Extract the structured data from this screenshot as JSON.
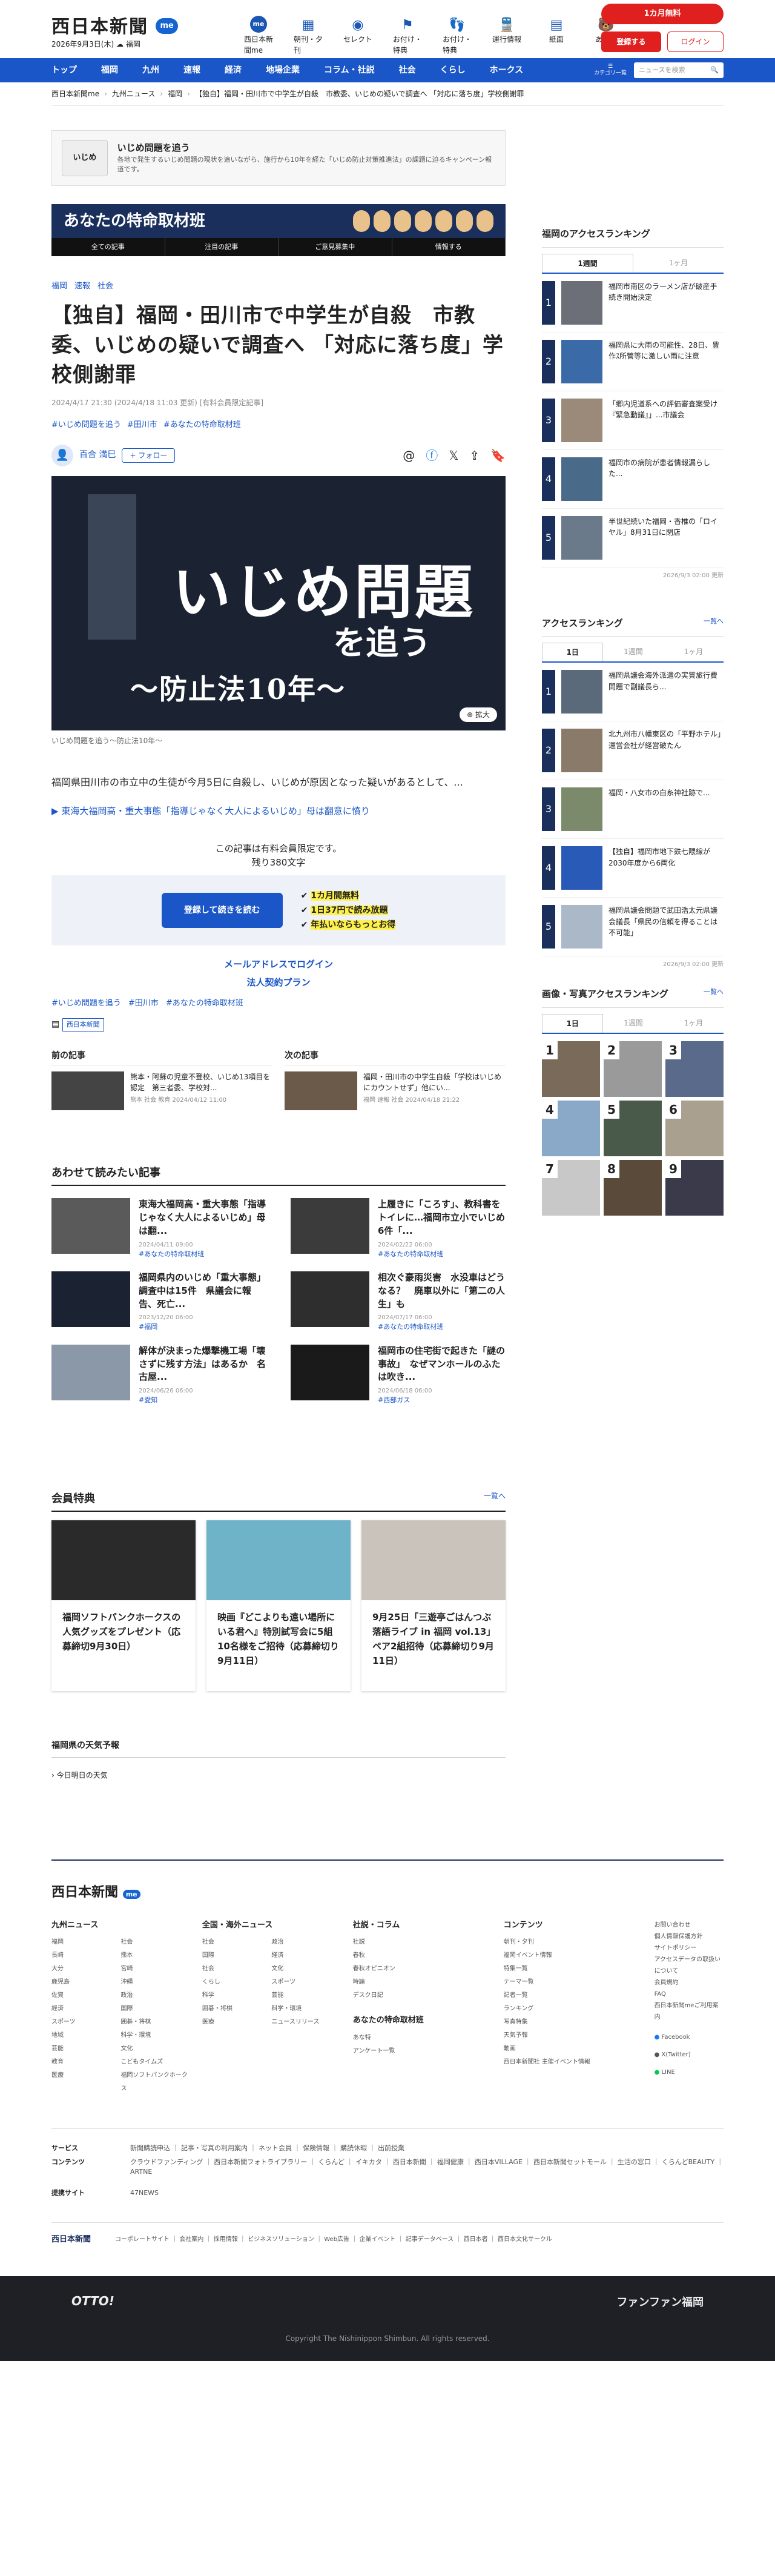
{
  "header": {
    "logo": "西日本新聞",
    "logo_badge": "me",
    "date": "2026年9月3日(木)",
    "region_label": "福岡",
    "icons": [
      {
        "label": "西日本新聞me",
        "icon": "me-icon"
      },
      {
        "label": "朝刊・夕刊",
        "icon": "newspaper-icon"
      },
      {
        "label": "セレクト",
        "icon": "select-icon"
      },
      {
        "label": "お付け・特典",
        "icon": "gift-icon"
      },
      {
        "label": "お付け・特典",
        "icon": "footprints-icon"
      },
      {
        "label": "運行情報",
        "icon": "train-icon"
      },
      {
        "label": "紙面",
        "icon": "paper-icon"
      },
      {
        "label": "あな特",
        "icon": "mascot-icon"
      }
    ],
    "subscribe_label": "1カ月無料",
    "register_label": "登録する",
    "login_label": "ログイン"
  },
  "nav": {
    "items": [
      "トップ",
      "福岡",
      "九州",
      "速報",
      "経済",
      "地場企業",
      "コラム・社説",
      "社会",
      "くらし",
      "ホークス"
    ],
    "category_label": "カテゴリ一覧",
    "search_placeholder": "ニュースを検索"
  },
  "breadcrumb": [
    "西日本新聞me",
    "九州ニュース",
    "福岡",
    "【独自】福岡・田川市で中学生が自殺　市教委、いじめの疑いで調査へ 「対応に落ち度」学校側謝罪"
  ],
  "series": {
    "thumb_label": "いじめ",
    "title": "いじめ問題を追う",
    "desc": "各地で発生するいじめ問題の現状を追いながら、施行から10年を経た「いじめ防止対策推進法」の課題に迫るキャンペーン報道です。"
  },
  "tokusyu": {
    "title": "あなたの特命取材班",
    "tabs": [
      "全ての記事",
      "注目の記事",
      "ご意見募集中",
      "情報する"
    ]
  },
  "article": {
    "tags": [
      "福岡",
      "速報",
      "社会"
    ],
    "title": "【独自】福岡・田川市で中学生が自殺　市教委、いじめの疑いで調査へ 「対応に落ち度」学校側謝罪",
    "meta": "2024/4/17 21:30 (2024/4/18 11:03 更新) [有料会員限定記事]",
    "series_tags": [
      "#いじめ問題を追う",
      "#田川市",
      "#あなたの特命取材班"
    ],
    "author": "百合 満巳",
    "follow_label": "+ フォロー",
    "hero_text_1": "いじめ",
    "hero_text_1b": "問題",
    "hero_text_2": "を追う",
    "hero_text_3": "〜防止法10年〜",
    "zoom_label": "拡大",
    "caption": "いじめ問題を追う〜防止法10年〜",
    "lead": "福岡県田川市の市立中の生徒が今月5日に自殺し、いじめが原因となった疑いがあるとして、...",
    "related_link": "東海大福岡高・重大事態「指導じゃなく大人によるいじめ」母は翻意に憤り"
  },
  "paywall": {
    "note": "この記事は有料会員限定です。",
    "remaining": "残り380文字",
    "button": "登録して続きを読む",
    "benefits": [
      "1カ月間無料",
      "1日37円で読み放題",
      "年払いならもっとお得"
    ],
    "mail_login": "メールアドレスでログイン",
    "corp_plan": "法人契約プラン"
  },
  "bottom_tags": [
    "#いじめ問題を追う",
    "#田川市",
    "#あなたの特命取材班"
  ],
  "publisher": "西日本新聞",
  "prev_next": {
    "prev_label": "前の記事",
    "prev_title": "熊本・阿蘇の児童不登校、いじめ13項目を認定　第三者委、学校対...",
    "prev_meta": "熊本 社会 教育 2024/04/12 11:00",
    "next_label": "次の記事",
    "next_title": "福岡・田川市の中学生自殺「学校はいじめにカウントせず」他にい...",
    "next_meta": "福岡 速報 社会 2024/04/18 21:22"
  },
  "also_read": {
    "heading": "あわせて読みたい記事",
    "items": [
      {
        "title": "東海大福岡高・重大事態「指導じゃなく大人によるいじめ」母は翻...",
        "date": "2024/04/11 09:00",
        "tag": "#あなたの特命取材班"
      },
      {
        "title": "上履きに「ころす」、教科書をトイレに…福岡市立小でいじめ6件「...",
        "date": "2024/02/22 06:00",
        "tag": "#あなたの特命取材班"
      },
      {
        "title": "福岡県内のいじめ「重大事態」調査中は15件　県議会に報告、死亡...",
        "date": "2023/12/20 06:00",
        "tag": "#福岡"
      },
      {
        "title": "相次ぐ豪雨災害　水没車はどうなる？　廃車以外に「第二の人生」も",
        "date": "2024/07/17 06:00",
        "tag": "#あなたの特命取材班"
      },
      {
        "title": "解体が決まった爆撃機工場「壊さずに残す方法」はあるか　名古屋...",
        "date": "2024/06/26 06:00",
        "tag": "#愛知"
      },
      {
        "title": "福岡市の住宅街で起きた「謎の事故」　なぜマンホールのふたは吹き...",
        "date": "2024/06/18 06:00",
        "tag": "#西部ガス"
      }
    ]
  },
  "perks": {
    "heading": "会員特典",
    "more": "一覧へ",
    "items": [
      "福岡ソフトバンクホークスの人気グッズをプレゼント（応募締切9月30日）",
      "映画『どこよりも遠い場所にいる君へ』特別試写会に5組10名様をご招待（応募締切り9月11日）",
      "9月25日「三遊亭ごはんつぶ 落語ライブ in 福岡 vol.13」ペア2組招待（応募締切り9月11日）"
    ]
  },
  "weather": {
    "heading": "福岡県の天気予報",
    "sub": "今日明日の天気"
  },
  "sidebar": {
    "access_heading": "福岡のアクセスランキング",
    "tabs": [
      "1週間",
      "1ヶ月"
    ],
    "ranking": [
      "福岡市南区のラーメン店が破産手続き開始決定",
      "福岡県に大雨の可能性、28日、豊作ｽ所管等に激しい雨に注意",
      "「郷内児道系への評価審査案受け『緊急動議』」...市議会",
      "福岡市の病院が患者情報漏らした...",
      "半世紀続いた福岡・香椎の「ロイヤル」8月31日に閉店"
    ],
    "updated": "2026/9/3 02:00 更新",
    "ranking2_heading": "アクセスランキング",
    "ranking2_more": "一覧へ",
    "tabs2": [
      "1日",
      "1週間",
      "1ヶ月"
    ],
    "ranking2": [
      "福岡県議会海外派遣の実質旅行費問題で副議長ら...",
      "北九州市八幡東区の「平野ホテル」運営会社が経営破たん",
      "福岡・八女市の白糸神社跡で..."
    ],
    "ranking2_more_items": [
      "【独自】福岡市地下鉄七隈線が2030年度から6両化",
      "福岡県議会問題で武田浩太元県議会議長「県民の信頼を得ることは不可能」"
    ],
    "updated2": "2026/9/3 02:00 更新",
    "photo_heading": "画像・写真アクセスランキング",
    "photo_more": "一覧へ",
    "photo_tabs": [
      "1日",
      "1週間",
      "1ヶ月"
    ],
    "photo_nums": [
      "1",
      "2",
      "3",
      "4",
      "5",
      "6",
      "7",
      "8",
      "9"
    ]
  },
  "footer": {
    "logo": "西日本新聞",
    "col1_title": "九州ニュース",
    "col1_items": [
      "福岡",
      "社会",
      "長崎",
      "熊本",
      "大分",
      "宮崎",
      "鹿児島",
      "沖縄",
      "佐賀",
      "政治",
      "経済",
      "国際",
      "スポーツ",
      "囲碁・将棋",
      "地域",
      "科学・環境",
      "芸能",
      "文化",
      "教育",
      "こどもタイムズ",
      "医療",
      "福岡ソフトバンクホークス"
    ],
    "col2_title": "全国・海外ニュース",
    "col2_items": [
      "社会",
      "政治",
      "国際",
      "経済",
      "社会",
      "文化",
      "くらし",
      "スポーツ",
      "科学",
      "芸能",
      "囲碁・将棋",
      "科学・環境",
      "医療",
      "ニュースリリース"
    ],
    "col3_title": "社説・コラム",
    "col3_items": [
      "社説",
      "春秋",
      "春秋オピニオン",
      "時論",
      "デスク日記"
    ],
    "col3b_title": "あなたの特命取材班",
    "col3b_items": [
      "あな特",
      "アンケート一覧"
    ],
    "col4_title": "コンテンツ",
    "col4_items": [
      "朝刊・夕刊",
      "福岡イベント情報",
      "特集一覧",
      "テーマ一覧",
      "記者一覧",
      "ランキング",
      "写真特集",
      "天気予報",
      "動画",
      "西日本新聞社 主催イベント情報"
    ],
    "sub_links": [
      "お問い合わせ",
      "個人情報保護方針",
      "サイトポリシー",
      "アクセスデータの取扱いについて",
      "会員規約",
      "FAQ",
      "西日本新聞meご利用案内"
    ],
    "social": [
      "Facebook",
      "X(Twitter)",
      "LINE"
    ],
    "services_label": "サービス",
    "services": "新聞購読申込 ｜ 記事・写真の利用案内 ｜ ネット会員 ｜ 保険情報 ｜ 購読休暇 ｜ 出前授業",
    "contents_label": "コンテンツ",
    "contents": "クラウドファンディング ｜ 西日本新聞フォトライブラリー ｜ くらんど ｜ イキカタ ｜ 西日本新聞 ｜ 福岡健康 ｜ 西日本VILLAGE ｜ 西日本新聞セットモール ｜ 生活の窓口 ｜ くらんどBEAUTY ｜ ARTNE",
    "partner_label": "提携サイト",
    "partner": "47NEWS",
    "bottom_logo": "西日本新聞",
    "bottom_links": "コーポレートサイト ｜ 会社案内 ｜ 採用情報 ｜ ビジネスソリューション ｜ Web広告 ｜ 企業イベント ｜ 記事データベース ｜ 西日本者 ｜ 西日本文化サークル",
    "otto": "OTTO!",
    "funfan": "ファンファン福岡",
    "copyright": "Copyright The Nishinippon Shimbun. All rights reserved."
  },
  "colors": {
    "brand_blue": "#1a56c7",
    "accent_red": "#e0201f",
    "navy": "#1b2f5c"
  }
}
